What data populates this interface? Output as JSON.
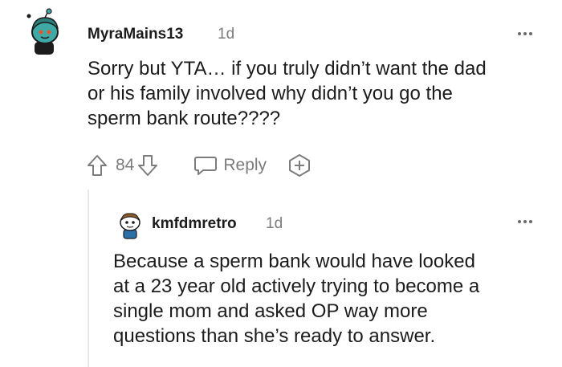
{
  "comment": {
    "username": "MyraMains13",
    "time": "1d",
    "lines": [
      "Sorry but YTA… if you truly didn’t want the dad",
      "or his family involved why didn’t you go the",
      "sperm bank route????"
    ],
    "vote_count": "84",
    "reply_label": "Reply",
    "icons": [
      "more-icon",
      "upvote-icon",
      "downvote-icon",
      "reply-icon",
      "award-icon"
    ]
  },
  "reply": {
    "username": "kmfdmretro",
    "time": "1d",
    "lines": [
      "Because a sperm bank would have looked",
      "at a 23 year old actively trying to become a",
      "single mom and asked OP way more",
      "questions than she’s ready to answer."
    ],
    "icons": [
      "more-icon"
    ]
  },
  "colors": {
    "text": "#1c1c1c",
    "meta": "#7c7c7c",
    "avatar_teal": "#3fa9a5",
    "avatar_blue": "#2b6fa8"
  }
}
